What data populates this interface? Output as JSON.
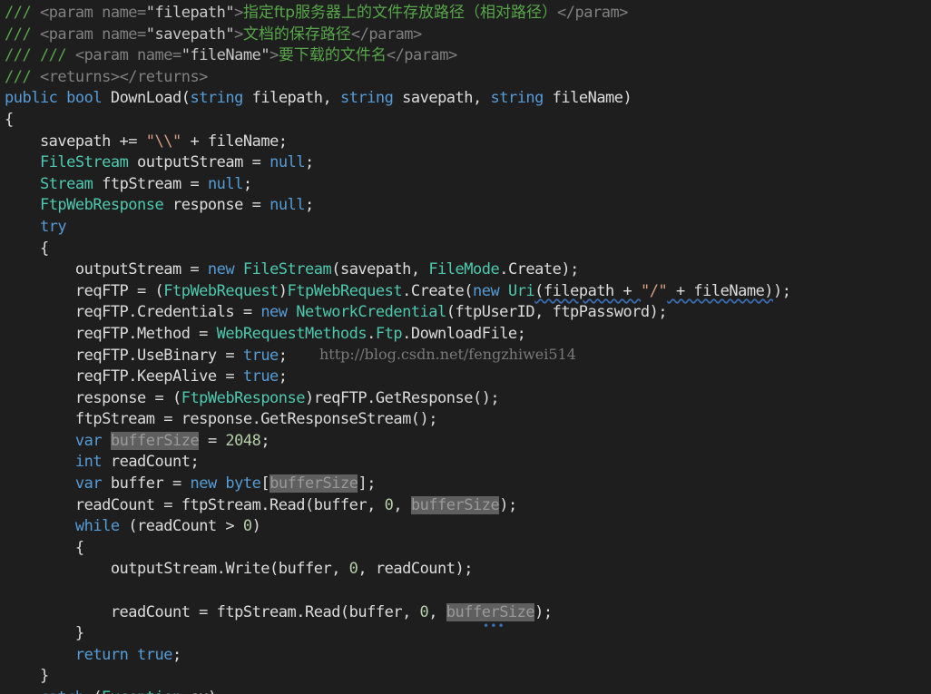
{
  "editor": {
    "watermark": "http://blog.csdn.net/fengzhiwei514",
    "ellipsis": "•••",
    "lines": [
      [
        {
          "k": "comment",
          "t": "/// "
        },
        {
          "k": "xmltag",
          "t": "<param name="
        },
        {
          "k": "xmlattr",
          "t": "\"filepath\""
        },
        {
          "k": "xmltag",
          "t": ">"
        },
        {
          "k": "cn",
          "t": "指定ftp服务器上的文件存放路径（相对路径）"
        },
        {
          "k": "xmltag",
          "t": "</param>"
        }
      ],
      [
        {
          "k": "comment",
          "t": "/// "
        },
        {
          "k": "xmltag",
          "t": "<param name="
        },
        {
          "k": "xmlattr",
          "t": "\"savepath\""
        },
        {
          "k": "xmltag",
          "t": ">"
        },
        {
          "k": "cn",
          "t": "文档的保存路径"
        },
        {
          "k": "xmltag",
          "t": "</param>"
        }
      ],
      [
        {
          "k": "comment",
          "t": "/// /// "
        },
        {
          "k": "xmltag",
          "t": "<param name="
        },
        {
          "k": "xmlattr",
          "t": "\"fileName\""
        },
        {
          "k": "xmltag",
          "t": ">"
        },
        {
          "k": "cn",
          "t": "要下载的文件名"
        },
        {
          "k": "xmltag",
          "t": "</param>"
        }
      ],
      [
        {
          "k": "comment",
          "t": "/// "
        },
        {
          "k": "xmltag",
          "t": "<returns></returns>"
        }
      ],
      [
        {
          "k": "keyword",
          "t": "public bool "
        },
        {
          "k": "plain",
          "t": "DownLoad("
        },
        {
          "k": "keyword",
          "t": "string "
        },
        {
          "k": "plain",
          "t": "filepath, "
        },
        {
          "k": "keyword",
          "t": "string "
        },
        {
          "k": "plain",
          "t": "savepath, "
        },
        {
          "k": "keyword",
          "t": "string "
        },
        {
          "k": "plain",
          "t": "fileName)"
        }
      ],
      [
        {
          "k": "plain",
          "t": "{"
        }
      ],
      [
        {
          "k": "plain",
          "t": "    savepath += "
        },
        {
          "k": "string",
          "t": "\"\\\\\""
        },
        {
          "k": "plain",
          "t": " + fileName;"
        }
      ],
      [
        {
          "k": "plain",
          "t": "    "
        },
        {
          "k": "type",
          "t": "FileStream"
        },
        {
          "k": "plain",
          "t": " outputStream = "
        },
        {
          "k": "keyword",
          "t": "null"
        },
        {
          "k": "plain",
          "t": ";"
        }
      ],
      [
        {
          "k": "plain",
          "t": "    "
        },
        {
          "k": "type",
          "t": "Stream"
        },
        {
          "k": "plain",
          "t": " ftpStream = "
        },
        {
          "k": "keyword",
          "t": "null"
        },
        {
          "k": "plain",
          "t": ";"
        }
      ],
      [
        {
          "k": "plain",
          "t": "    "
        },
        {
          "k": "type",
          "t": "FtpWebResponse"
        },
        {
          "k": "plain",
          "t": " response = "
        },
        {
          "k": "keyword",
          "t": "null"
        },
        {
          "k": "plain",
          "t": ";"
        }
      ],
      [
        {
          "k": "plain",
          "t": "    "
        },
        {
          "k": "keyword",
          "t": "try"
        }
      ],
      [
        {
          "k": "plain",
          "t": "    {"
        }
      ],
      [
        {
          "k": "plain",
          "t": "        outputStream = "
        },
        {
          "k": "keyword",
          "t": "new "
        },
        {
          "k": "type",
          "t": "FileStream"
        },
        {
          "k": "plain",
          "t": "(savepath, "
        },
        {
          "k": "type",
          "t": "FileMode"
        },
        {
          "k": "plain",
          "t": ".Create);"
        }
      ],
      [
        {
          "k": "plain",
          "t": "        reqFTP = ("
        },
        {
          "k": "type",
          "t": "FtpWebRequest"
        },
        {
          "k": "plain",
          "t": ")"
        },
        {
          "k": "type",
          "t": "FtpWebRequest"
        },
        {
          "k": "plain",
          "t": ".Create("
        },
        {
          "k": "keyword",
          "t": "new "
        },
        {
          "k": "type",
          "t": "Uri"
        },
        {
          "k": "squiggle",
          "t": "(filepath + "
        },
        {
          "k": "string",
          "t": "\"/\""
        },
        {
          "k": "squiggle",
          "t": " + fileName)"
        },
        {
          "k": "plain",
          "t": ");"
        }
      ],
      [
        {
          "k": "plain",
          "t": "        reqFTP.Credentials = "
        },
        {
          "k": "keyword",
          "t": "new "
        },
        {
          "k": "type",
          "t": "NetworkCredential"
        },
        {
          "k": "plain",
          "t": "(ftpUserID, ftpPassword);"
        }
      ],
      [
        {
          "k": "plain",
          "t": "        reqFTP.Method = "
        },
        {
          "k": "type",
          "t": "WebRequestMethods"
        },
        {
          "k": "plain",
          "t": "."
        },
        {
          "k": "type",
          "t": "Ftp"
        },
        {
          "k": "plain",
          "t": ".DownloadFile;"
        }
      ],
      [
        {
          "k": "plain",
          "t": "        reqFTP.UseBinary = "
        },
        {
          "k": "keyword",
          "t": "true"
        },
        {
          "k": "plain",
          "t": ";"
        }
      ],
      [
        {
          "k": "plain",
          "t": "        reqFTP.KeepAlive = "
        },
        {
          "k": "keyword",
          "t": "true"
        },
        {
          "k": "plain",
          "t": ";"
        }
      ],
      [
        {
          "k": "plain",
          "t": "        response = ("
        },
        {
          "k": "type",
          "t": "FtpWebResponse"
        },
        {
          "k": "plain",
          "t": ")reqFTP.GetResponse();"
        }
      ],
      [
        {
          "k": "plain",
          "t": "        ftpStream = response.GetResponseStream();"
        }
      ],
      [
        {
          "k": "plain",
          "t": "        "
        },
        {
          "k": "keyword",
          "t": "var "
        },
        {
          "k": "hl",
          "t": "bufferSize"
        },
        {
          "k": "plain",
          "t": " = "
        },
        {
          "k": "number",
          "t": "2048"
        },
        {
          "k": "plain",
          "t": ";"
        }
      ],
      [
        {
          "k": "plain",
          "t": "        "
        },
        {
          "k": "keyword",
          "t": "int "
        },
        {
          "k": "plain",
          "t": "readCount;"
        }
      ],
      [
        {
          "k": "plain",
          "t": "        "
        },
        {
          "k": "keyword",
          "t": "var "
        },
        {
          "k": "plain",
          "t": "buffer = "
        },
        {
          "k": "keyword",
          "t": "new byte"
        },
        {
          "k": "plain",
          "t": "["
        },
        {
          "k": "hl",
          "t": "bufferSize"
        },
        {
          "k": "plain",
          "t": "];"
        }
      ],
      [
        {
          "k": "plain",
          "t": "        readCount = ftpStream.Read(buffer, "
        },
        {
          "k": "number",
          "t": "0"
        },
        {
          "k": "plain",
          "t": ", "
        },
        {
          "k": "hl",
          "t": "bufferSize"
        },
        {
          "k": "plain",
          "t": ");"
        }
      ],
      [
        {
          "k": "plain",
          "t": "        "
        },
        {
          "k": "keyword",
          "t": "while "
        },
        {
          "k": "plain",
          "t": "(readCount > "
        },
        {
          "k": "number",
          "t": "0"
        },
        {
          "k": "plain",
          "t": ")"
        }
      ],
      [
        {
          "k": "plain",
          "t": "        {"
        }
      ],
      [
        {
          "k": "plain",
          "t": "            outputStream.Write(buffer, "
        },
        {
          "k": "number",
          "t": "0"
        },
        {
          "k": "plain",
          "t": ", readCount);"
        }
      ],
      [
        {
          "k": "plain",
          "t": ""
        }
      ],
      [
        {
          "k": "plain",
          "t": "            readCount = ftpStream.Read(buffer, "
        },
        {
          "k": "number",
          "t": "0"
        },
        {
          "k": "plain",
          "t": ", "
        },
        {
          "k": "hl",
          "t": "bufferSize"
        },
        {
          "k": "plain",
          "t": ");"
        }
      ],
      [
        {
          "k": "plain",
          "t": "        }"
        }
      ],
      [
        {
          "k": "plain",
          "t": "        "
        },
        {
          "k": "keyword",
          "t": "return true"
        },
        {
          "k": "plain",
          "t": ";"
        }
      ],
      [
        {
          "k": "plain",
          "t": "    }"
        }
      ],
      [
        {
          "k": "plain",
          "t": "    "
        },
        {
          "k": "keyword",
          "t": "catch "
        },
        {
          "k": "plain",
          "t": "("
        },
        {
          "k": "type",
          "t": "Exception"
        },
        {
          "k": "plain",
          "t": " ex)"
        }
      ]
    ]
  }
}
